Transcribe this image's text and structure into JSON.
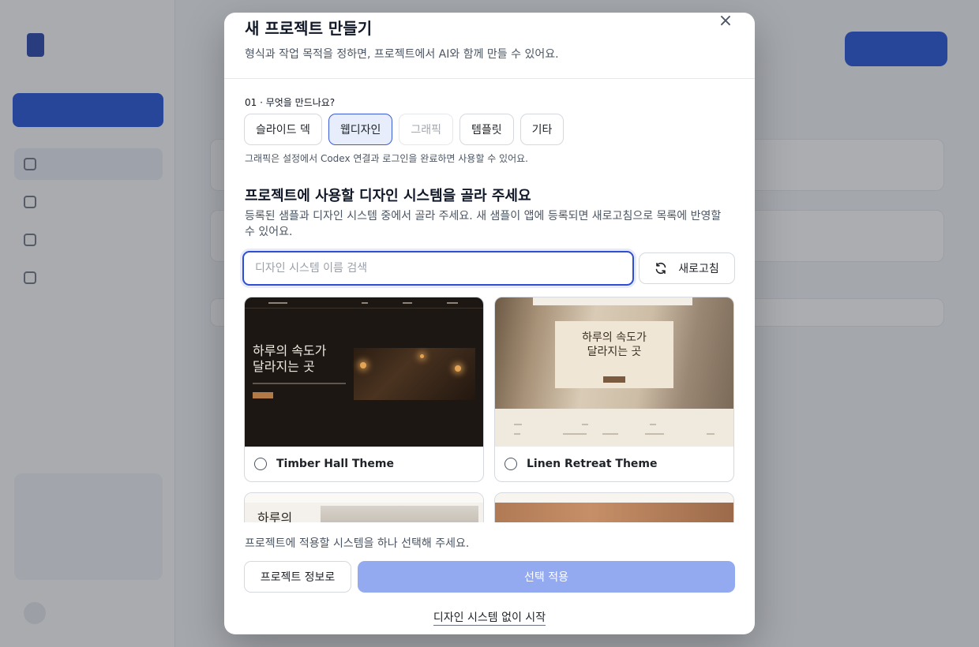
{
  "modal": {
    "title": "새 프로젝트 만들기",
    "subtitle": "형식과 작업 목적을 정하면, 프로젝트에서 AI와 함께 만들 수 있어요.",
    "close_glyph": "×"
  },
  "step": {
    "label": "01 · 무엇을 만드나요?",
    "types": [
      {
        "label": "슬라이드 덱",
        "state": "default"
      },
      {
        "label": "웹디자인",
        "state": "selected"
      },
      {
        "label": "그래픽",
        "state": "disabled"
      },
      {
        "label": "템플릿",
        "state": "default"
      },
      {
        "label": "기타",
        "state": "default"
      }
    ],
    "note": "그래픽은 설정에서 Codex 연결과 로그인을 완료하면 사용할 수 있어요."
  },
  "design_system": {
    "title": "프로젝트에 사용할 디자인 시스템을 골라 주세요",
    "description": "등록된 샘플과 디자인 시스템 중에서 골라 주세요. 새 샘플이 앱에 등록되면 새로고침으로 목록에 반영할 수 있어요.",
    "search_placeholder": "디자인 시스템 이름 검색",
    "refresh_label": "새로고침",
    "cards": [
      {
        "name": "Timber Hall Theme",
        "preview_heading": "하루의 속도가\n달라지는 곳"
      },
      {
        "name": "Linen Retreat Theme",
        "preview_heading": "하루의 속도가\n달라지는 곳"
      },
      {
        "name": "",
        "preview_heading": "하루의"
      },
      {
        "name": "",
        "preview_heading": ""
      }
    ]
  },
  "footer": {
    "hint": "프로젝트에 적용할 시스템을 하나 선택해 주세요.",
    "back_label": "프로젝트 정보로",
    "apply_label": "선택 적용",
    "skip_label": "디자인 시스템 없이 시작"
  },
  "colors": {
    "accent": "#2e4fd2",
    "apply_disabled": "#93aaf0",
    "selected_bg": "#e7edfb"
  }
}
